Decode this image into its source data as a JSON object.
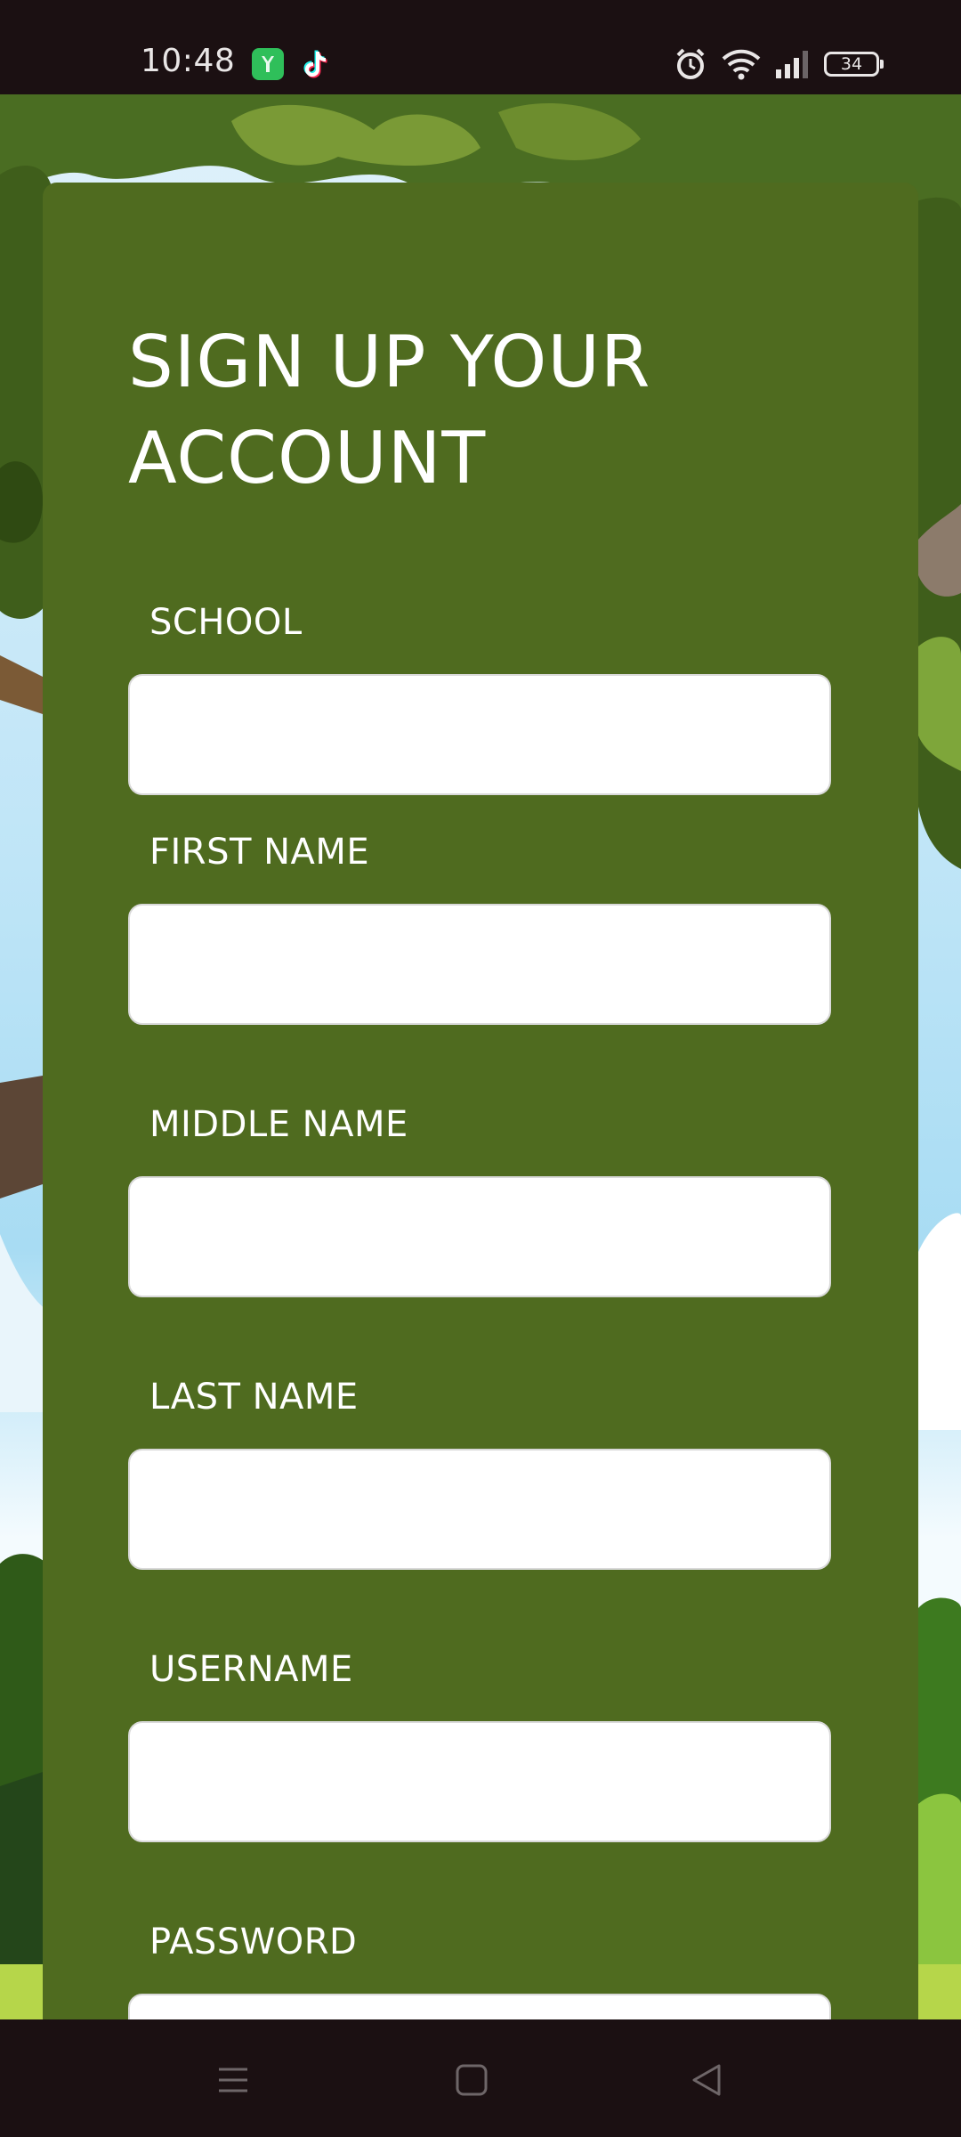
{
  "status_bar": {
    "time": "10:48",
    "battery_level": "34",
    "notification_icons": [
      "store-app-icon",
      "tiktok-icon"
    ],
    "system_icons": [
      "alarm-icon",
      "wifi-icon",
      "signal-icon",
      "battery-icon"
    ]
  },
  "form": {
    "title": "SIGN UP YOUR ACCOUNT",
    "fields": [
      {
        "label": "SCHOOL",
        "value": "",
        "placeholder": ""
      },
      {
        "label": "FIRST NAME",
        "value": "",
        "placeholder": ""
      },
      {
        "label": "MIDDLE NAME",
        "value": "",
        "placeholder": ""
      },
      {
        "label": "LAST NAME",
        "value": "",
        "placeholder": ""
      },
      {
        "label": "USERNAME",
        "value": "",
        "placeholder": ""
      },
      {
        "label": "PASSWORD",
        "value": "",
        "placeholder": ""
      }
    ]
  },
  "nav_bar": {
    "buttons": [
      "menu-icon",
      "home-icon",
      "back-icon"
    ]
  },
  "colors": {
    "card_background": "#4f6b1f",
    "status_bar_background": "#1b1012",
    "input_background": "#ffffff",
    "label_text": "#ffffff"
  }
}
